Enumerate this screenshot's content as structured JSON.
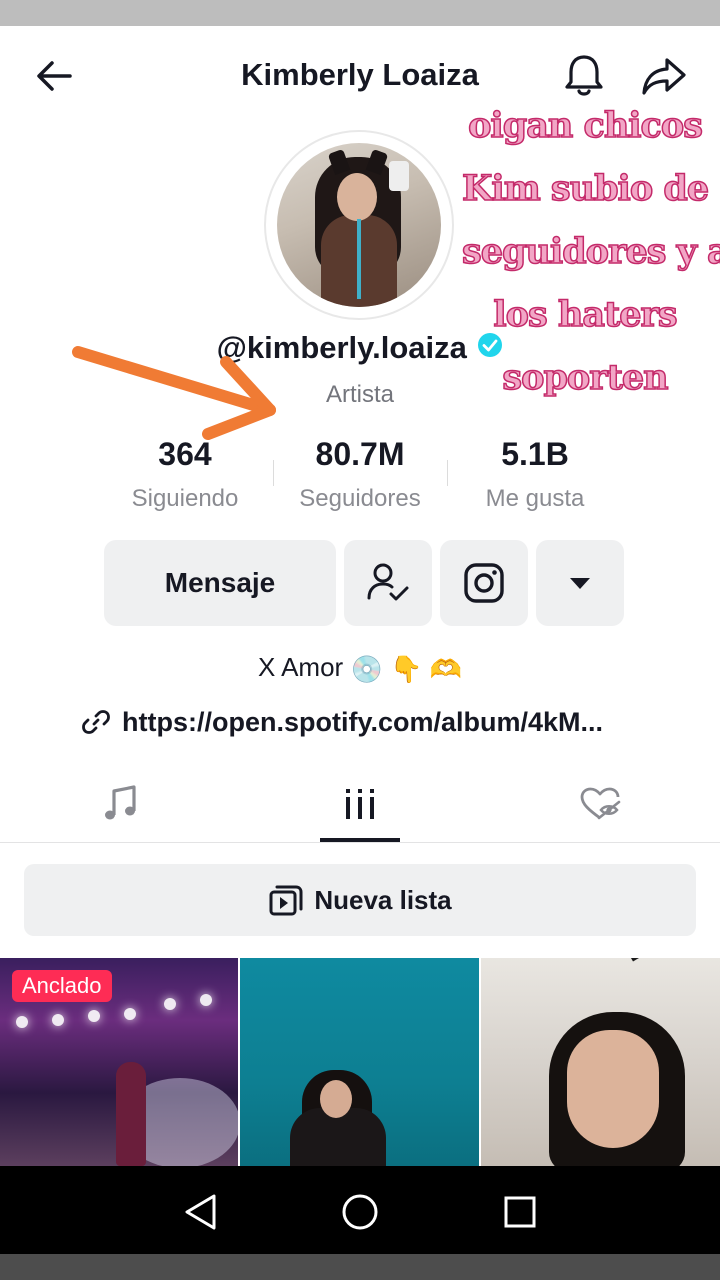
{
  "header": {
    "title": "Kimberly Loaiza",
    "back_icon": "arrow-left-icon",
    "bell_icon": "bell-icon",
    "share_icon": "share-arrow-icon"
  },
  "profile": {
    "username": "@kimberly.loaiza",
    "verified": true,
    "category": "Artista",
    "stats": [
      {
        "value": "364",
        "label": "Siguiendo"
      },
      {
        "value": "80.7M",
        "label": "Seguidores"
      },
      {
        "value": "5.1B",
        "label": "Me gusta"
      }
    ]
  },
  "actions": {
    "message_label": "Mensaje",
    "follow_icon": "person-check-icon",
    "instagram_icon": "instagram-icon",
    "more_icon": "caret-down-icon"
  },
  "bio": {
    "text": "X Amor",
    "emoji_1": "💿",
    "emoji_2": "👇",
    "emoji_3": "🫶",
    "link_icon": "link-icon",
    "link": "https://open.spotify.com/album/4kM..."
  },
  "tabs": [
    {
      "name": "music-tab",
      "icon": "music-note-icon"
    },
    {
      "name": "videos-tab",
      "icon": "grid-icon",
      "active": true
    },
    {
      "name": "liked-tab",
      "icon": "hidden-heart-icon"
    }
  ],
  "playlist": {
    "label": "Nueva lista",
    "icon": "playlist-icon"
  },
  "grid": {
    "pinned_label": "Anclado"
  },
  "overlay": {
    "lines": [
      "oigan chicos",
      "Kim subio de",
      "seguidores y a",
      "los haters",
      "soporten"
    ]
  },
  "colors": {
    "accent_red": "#fe2c55",
    "verified_blue": "#20d5ec",
    "overlay_pink": "#f2a6c6",
    "overlay_stroke": "#c42a6a",
    "arrow_orange": "#f07b34"
  }
}
